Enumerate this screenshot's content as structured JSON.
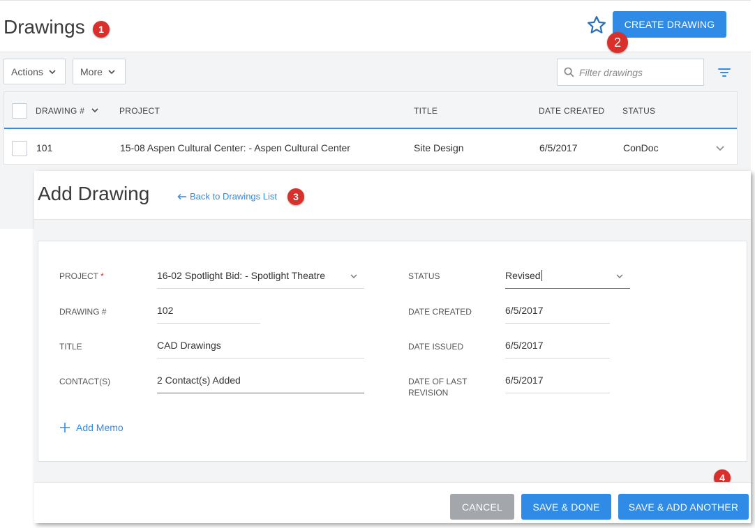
{
  "header": {
    "title": "Drawings",
    "create_button": "CREATE DRAWING"
  },
  "toolbar": {
    "actions_label": "Actions",
    "more_label": "More",
    "filter_placeholder": "Filter drawings"
  },
  "table": {
    "columns": [
      "DRAWING #",
      "PROJECT",
      "TITLE",
      "DATE CREATED",
      "STATUS"
    ],
    "rows": [
      {
        "number": "101",
        "project": "15-08 Aspen Cultural Center: - Aspen Cultural Center",
        "title": "Site Design",
        "date_created": "6/5/2017",
        "status": "ConDoc"
      }
    ]
  },
  "add_drawing": {
    "title": "Add Drawing",
    "back_link": "Back to Drawings List",
    "fields": {
      "project_label": "PROJECT",
      "project_required": "*",
      "project_value": "16-02 Spotlight Bid: - Spotlight Theatre",
      "drawing_label": "DRAWING #",
      "drawing_value": "102",
      "title_label": "TITLE",
      "title_value": "CAD Drawings",
      "contacts_label": "CONTACT(S)",
      "contacts_value": "2 Contact(s) Added",
      "status_label": "STATUS",
      "status_value": "Revised",
      "date_created_label": "DATE CREATED",
      "date_created_value": "6/5/2017",
      "date_issued_label": "DATE ISSUED",
      "date_issued_value": "6/5/2017",
      "date_revision_label_1": "DATE OF LAST",
      "date_revision_label_2": "REVISION",
      "date_revision_value": "6/5/2017"
    },
    "add_memo": "Add Memo",
    "buttons": {
      "cancel": "CANCEL",
      "save_done": "SAVE & DONE",
      "save_add": "SAVE & ADD ANOTHER"
    }
  },
  "callouts": [
    "1",
    "2",
    "3",
    "4"
  ],
  "colors": {
    "accent": "#2f8be6",
    "callout": "#d9302c",
    "cancel": "#a3a7ab"
  }
}
